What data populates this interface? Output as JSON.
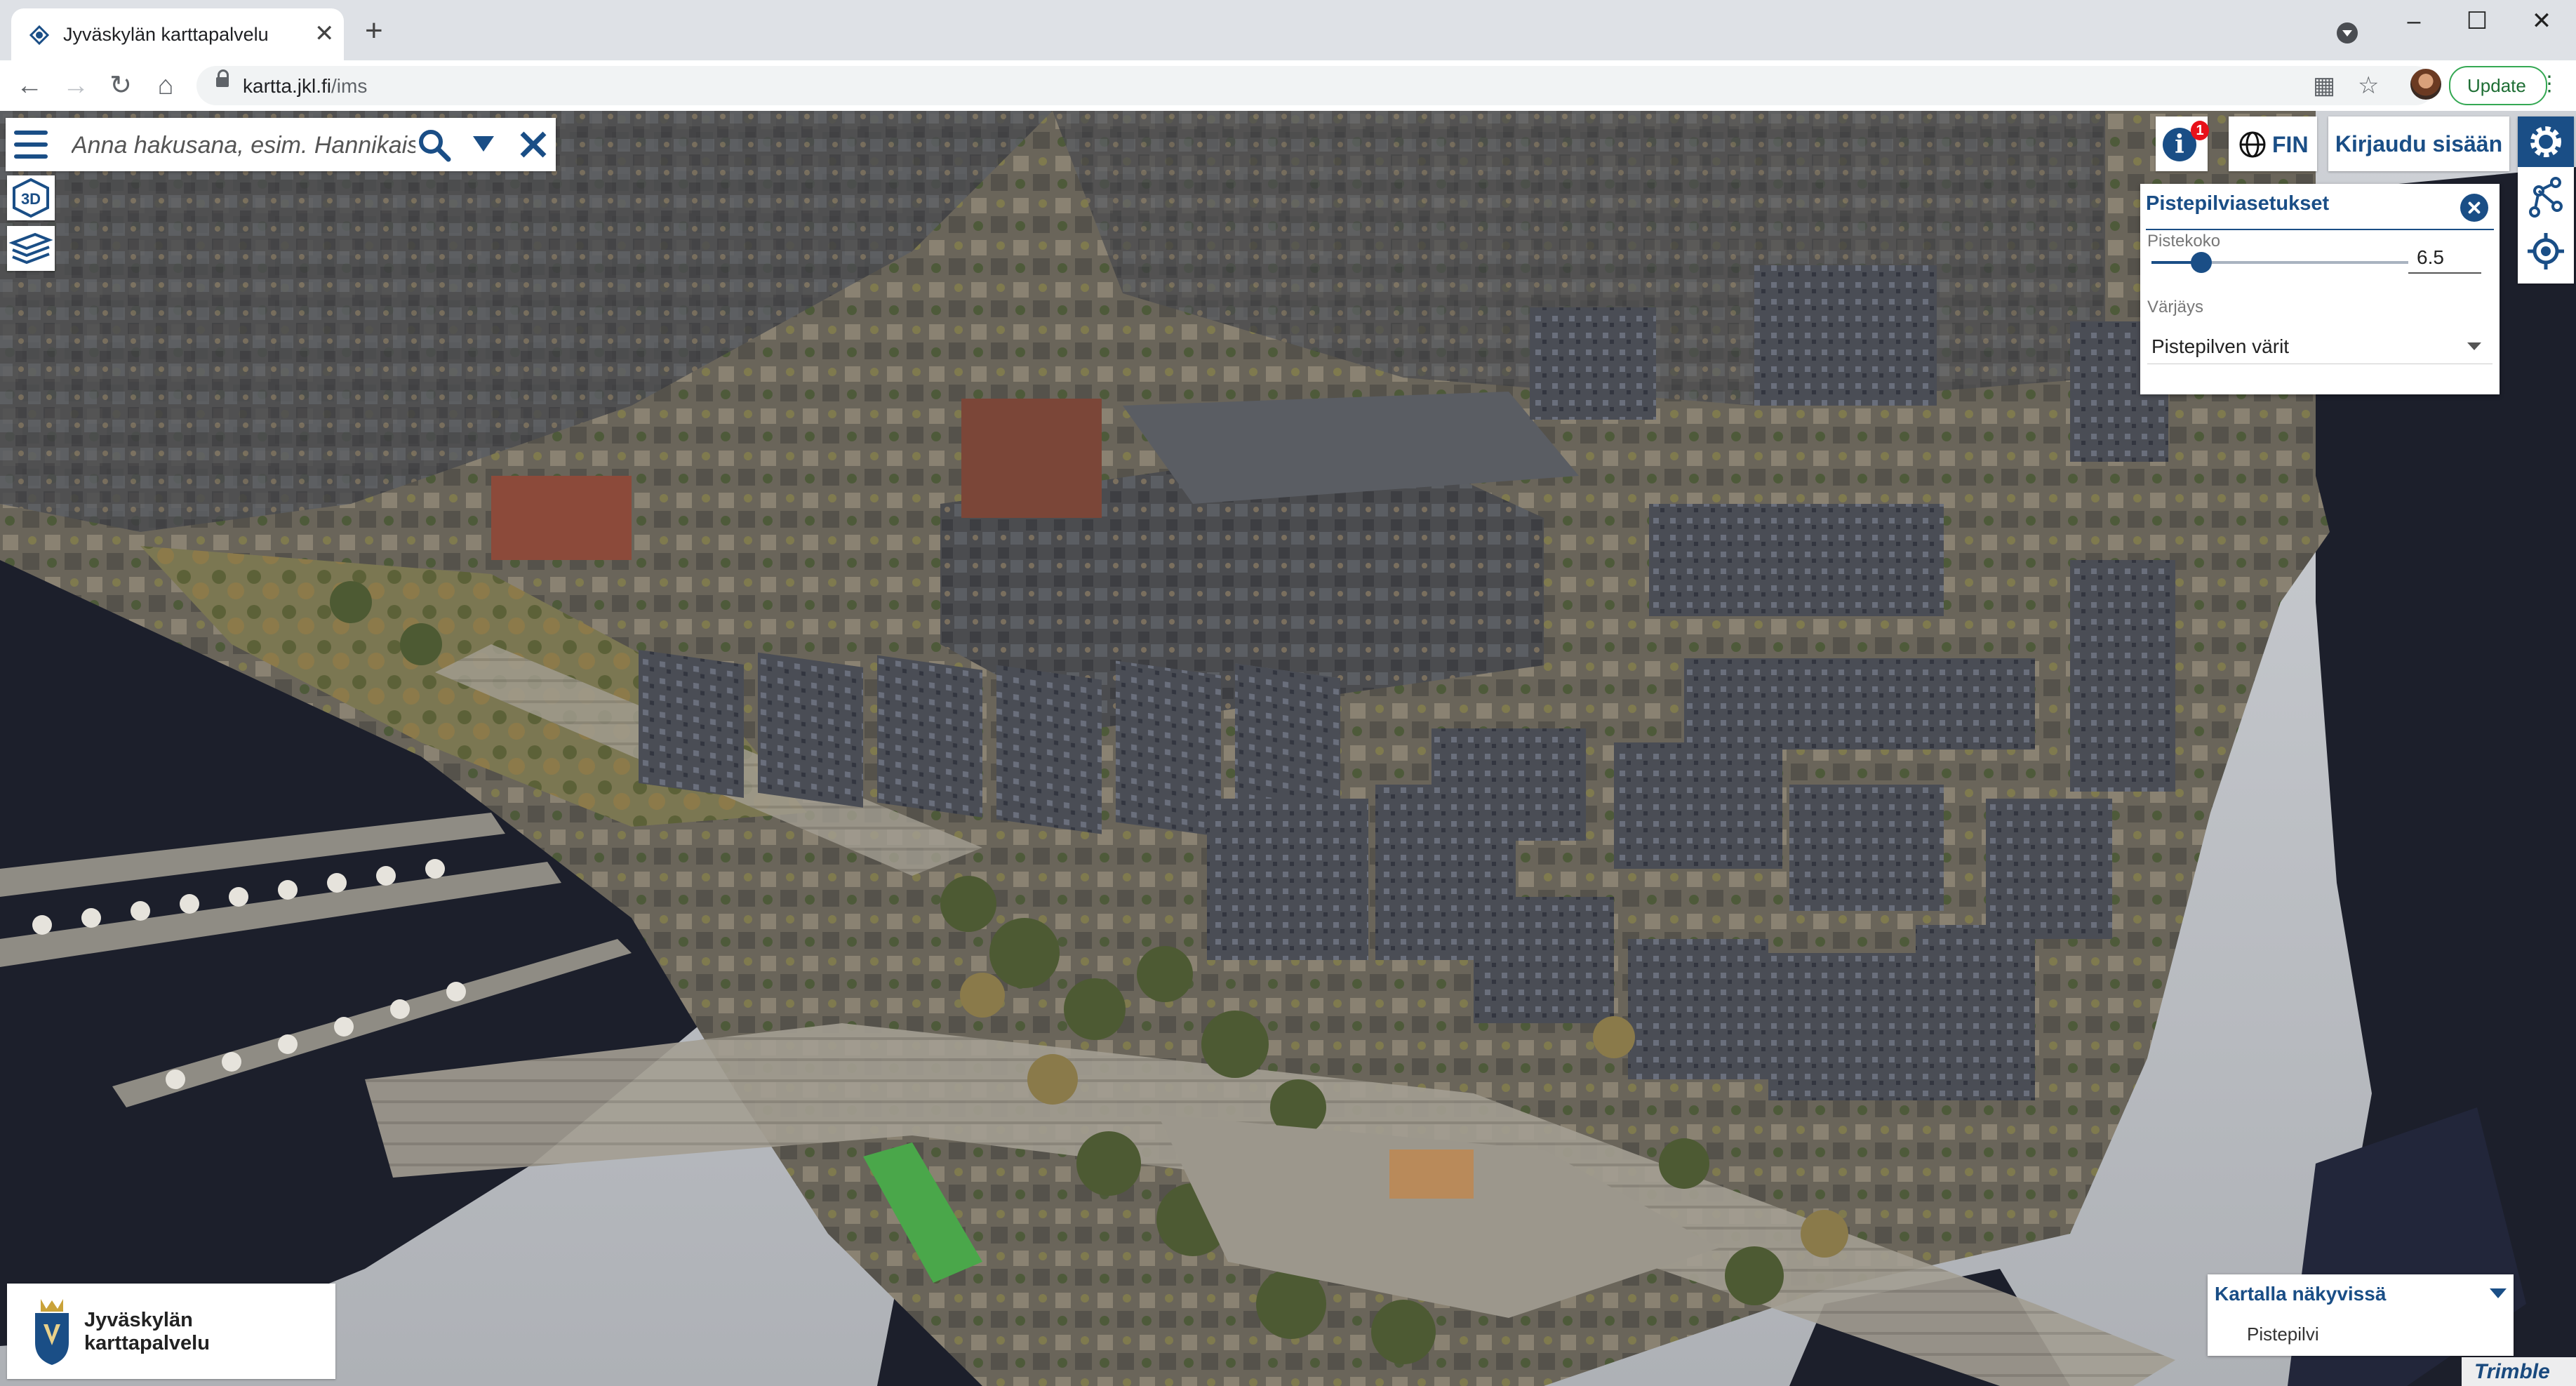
{
  "browser": {
    "tab_title": "Jyväskylän karttapalvelu",
    "url_host": "kartta.jkl.fi",
    "url_path": "/ims",
    "update_label": "Update"
  },
  "search": {
    "placeholder": "Anna hakusana, esim. Hannikaisenkatu"
  },
  "map_tools": [
    {
      "name": "3d-view",
      "icon": "3d-cube-icon"
    },
    {
      "name": "layers",
      "icon": "layers-icon"
    }
  ],
  "header": {
    "info_badge": "1",
    "language": "FIN",
    "login_label": "Kirjaudu sisään"
  },
  "settings_panel": {
    "title": "Pistepilviasetukset",
    "point_size_label": "Pistekoko",
    "point_size_value": "6.5",
    "point_size_fraction": 0.18,
    "coloring_label": "Värjäys",
    "coloring_value": "Pistepilven värit"
  },
  "logo": {
    "text": "Jyväskylän karttapalvelu"
  },
  "visible_on_map": {
    "title": "Kartalla näkyvissä",
    "items": [
      "Pistepilvi"
    ]
  },
  "attribution": "Trimble",
  "colors": {
    "accent": "#1a4e86",
    "badge": "#e8111a",
    "update_green": "#34a853",
    "water": "#1c1f2b"
  }
}
